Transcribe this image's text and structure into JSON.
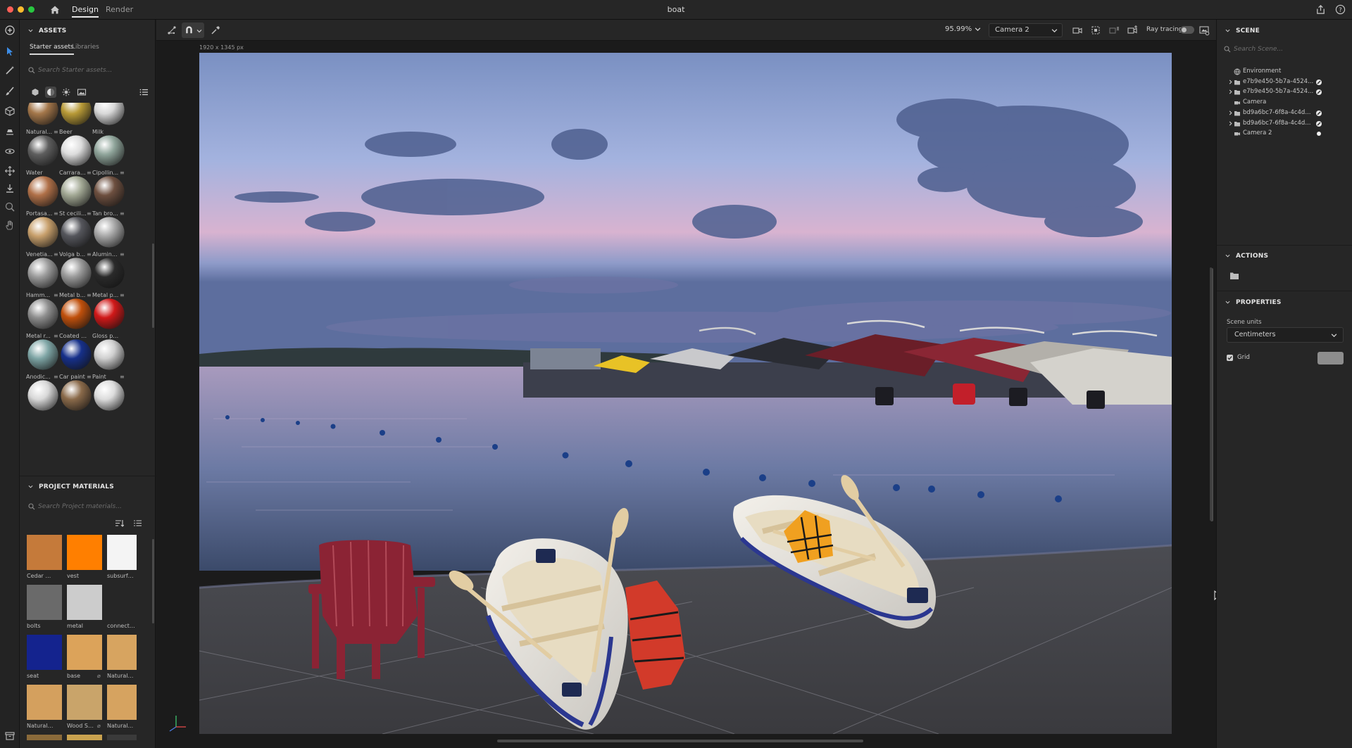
{
  "titlebar": {
    "tabs": [
      {
        "label": "Design"
      },
      {
        "label": "Render"
      }
    ],
    "document_title": "boat"
  },
  "assets": {
    "section_title": "ASSETS",
    "tabs": [
      {
        "label": "Starter assets"
      },
      {
        "label": "Libraries"
      }
    ],
    "search_placeholder": "Search Starter assets...",
    "materials": [
      {
        "label": "Natural...",
        "color": "#a4774a",
        "options": true
      },
      {
        "label": "Beer",
        "color": "#b89a37",
        "options": false
      },
      {
        "label": "Milk",
        "color": "#d8d8d8",
        "options": false
      },
      {
        "label": "Water",
        "color": "#5e5e5e",
        "options": false
      },
      {
        "label": "Carrara...",
        "color": "#dcdcdc",
        "options": true
      },
      {
        "label": "Cipollin...",
        "color": "#8fa49a",
        "options": true
      },
      {
        "label": "Portasa...",
        "color": "#b07048",
        "options": true
      },
      {
        "label": "St cecili...",
        "color": "#a2a894",
        "options": true
      },
      {
        "label": "Tan bro...",
        "color": "#6d4f3f",
        "options": true
      },
      {
        "label": "Venetia...",
        "color": "#c8a06c",
        "options": true
      },
      {
        "label": "Volga b...",
        "color": "#55565c",
        "options": true
      },
      {
        "label": "Alumin...",
        "color": "#a8a8a8",
        "options": true
      },
      {
        "label": "Hamm...",
        "color": "#9c9c9c",
        "options": true
      },
      {
        "label": "Metal b...",
        "color": "#9a9a9a",
        "options": true
      },
      {
        "label": "Metal p...",
        "color": "#2a2a2a",
        "options": true
      },
      {
        "label": "Metal r...",
        "color": "#8e8e8e",
        "options": true
      },
      {
        "label": "Coated me...",
        "color": "#c0500c",
        "options": false
      },
      {
        "label": "Gloss paint",
        "color": "#d01818",
        "options": false
      },
      {
        "label": "Anodic...",
        "color": "#7ea5a5",
        "options": true
      },
      {
        "label": "Car paint",
        "color": "#16308a",
        "options": true
      },
      {
        "label": "Paint",
        "color": "#cfcfcf",
        "options": true
      },
      {
        "label": "",
        "color": "#d8d8d8",
        "options": false
      },
      {
        "label": "",
        "color": "#8a6a4a",
        "options": false
      },
      {
        "label": "",
        "color": "#dcdcdc",
        "options": false
      }
    ]
  },
  "project_materials": {
    "section_title": "PROJECT MATERIALS",
    "search_placeholder": "Search Project materials...",
    "items": [
      {
        "label": "Cedar Wo...",
        "color": "#c57a3a",
        "options": false
      },
      {
        "label": "vest",
        "color": "#ff7f00",
        "options": false
      },
      {
        "label": "subsurfa...",
        "color": "#f4f4f4",
        "options": true
      },
      {
        "label": "bolts",
        "color": "#6a6a6a",
        "options": false
      },
      {
        "label": "metal",
        "color": "#cccccc",
        "options": false
      },
      {
        "label": "connector",
        "color": "#262626",
        "options": false
      },
      {
        "label": "seat",
        "color": "#14238e",
        "options": false
      },
      {
        "label": "base",
        "color": "#dca35a",
        "options": true
      },
      {
        "label": "Natural Su...",
        "color": "#d7a460",
        "options": false
      },
      {
        "label": "Natural Su...",
        "color": "#d4a05e",
        "options": false
      },
      {
        "label": "Wood Se...",
        "color": "#c9a46a",
        "options": true
      },
      {
        "label": "Natural...",
        "color": "#d6a360",
        "options": true
      },
      {
        "label": "",
        "color": "#8a6a3a",
        "options": false
      },
      {
        "label": "",
        "color": "#c9a24f",
        "options": false
      },
      {
        "label": "",
        "color": "#3a3a3a",
        "options": false
      }
    ]
  },
  "viewport": {
    "zoom": "95.99%",
    "camera": "Camera 2",
    "ray_tracing_label": "Ray tracing",
    "ray_tracing_on": false,
    "canvas_size": "1920 x 1345 px"
  },
  "scene": {
    "section_title": "SCENE",
    "search_placeholder": "Search Scene...",
    "items": [
      {
        "label": "Environment",
        "icon": "globe-icon",
        "expandable": false,
        "badge": ""
      },
      {
        "label": "e7b9e450-5b7a-4524...",
        "icon": "folder-icon",
        "expandable": true,
        "badge": "edit-material-icon"
      },
      {
        "label": "e7b9e450-5b7a-4524...",
        "icon": "folder-icon",
        "expandable": true,
        "badge": "edit-material-icon"
      },
      {
        "label": "Camera",
        "icon": "camera-icon",
        "expandable": false,
        "badge": ""
      },
      {
        "label": "bd9a6bc7-6f8a-4c4d...",
        "icon": "folder-icon",
        "expandable": true,
        "badge": "edit-material-icon"
      },
      {
        "label": "bd9a6bc7-6f8a-4c4d...",
        "icon": "folder-icon",
        "expandable": true,
        "badge": "edit-material-icon"
      },
      {
        "label": "Camera 2",
        "icon": "camera-icon",
        "expandable": false,
        "badge": "active-dot"
      }
    ]
  },
  "actions": {
    "section_title": "ACTIONS"
  },
  "properties": {
    "section_title": "PROPERTIES",
    "scene_units_label": "Scene units",
    "scene_units_value": "Centimeters",
    "grid_label": "Grid",
    "grid_checked": true,
    "grid_color": "#8d8d8d"
  }
}
